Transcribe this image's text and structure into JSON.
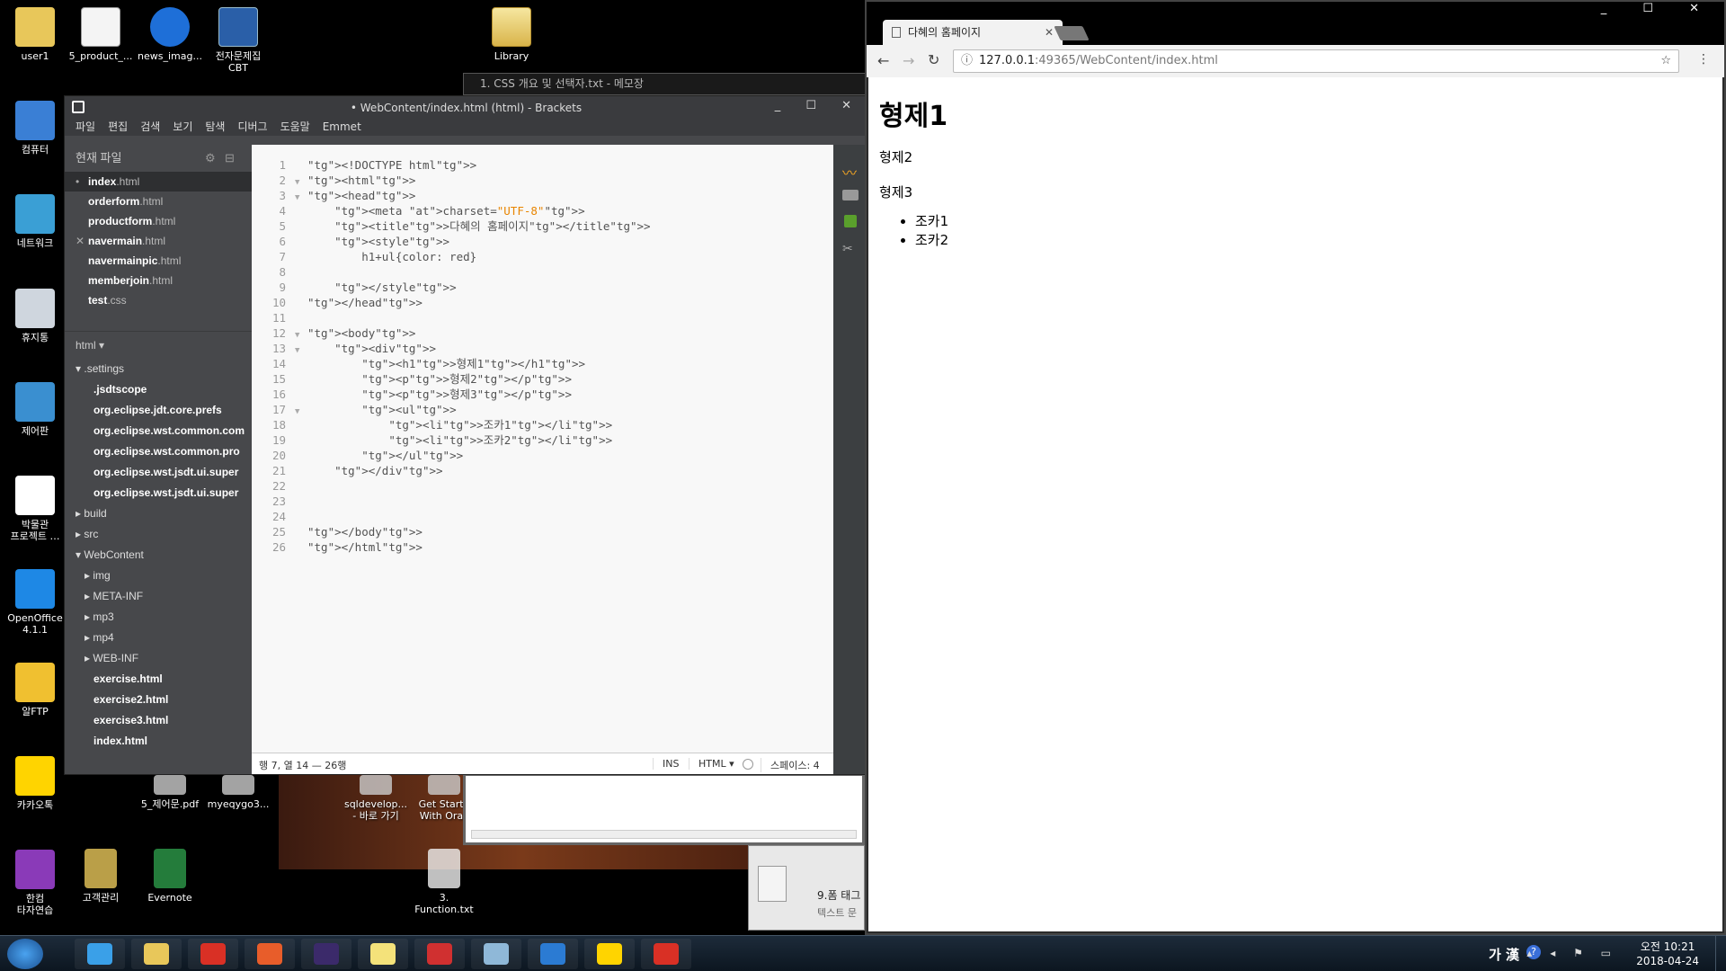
{
  "desktop": {
    "icons_left": [
      {
        "label": "user1",
        "color": "#e8c75a"
      },
      {
        "label": "컴퓨터",
        "color": "#3a7fd5"
      },
      {
        "label": "네트워크",
        "color": "#3a9fd5"
      },
      {
        "label": "휴지통",
        "color": "#cfd6de"
      },
      {
        "label": "제어판",
        "color": "#3a8fd0"
      },
      {
        "label": "박물관\n프로젝트 …",
        "color": "#ffffff"
      },
      {
        "label": "OpenOffice\n4.1.1",
        "color": "#1e88e5"
      },
      {
        "label": "알FTP",
        "color": "#f0c030"
      },
      {
        "label": "카카오톡",
        "color": "#ffd400"
      },
      {
        "label": "한컴\n타자연습",
        "color": "#8a3ab8"
      }
    ],
    "icons_top": [
      {
        "label": "5_product_...",
        "kind": "doc"
      },
      {
        "label": "news_imag...",
        "kind": "zip"
      },
      {
        "label": "전자문제집\nCBT",
        "kind": "app"
      },
      {
        "label": "Library",
        "kind": "folder"
      }
    ],
    "icons_bottom": [
      {
        "label": "5_제어문.pdf"
      },
      {
        "label": "myeqygo3..."
      },
      {
        "label": "sqldevelop...\n- 바로 가기"
      },
      {
        "label": "Get Starte\nWith Orac"
      },
      {
        "label": "고객관리"
      },
      {
        "label": "Evernote"
      },
      {
        "label": "3.\nFunction.txt"
      }
    ]
  },
  "notepad": {
    "title": "1. CSS 개요 및 선택자.txt - 메모장"
  },
  "notepad3": {
    "title": "9.폼 태그",
    "sub": "텍스트 문"
  },
  "brackets": {
    "title": "• WebContent/index.html (html) - Brackets",
    "window_controls": "_ ☐ ✕",
    "menu": [
      "파일",
      "편집",
      "검색",
      "보기",
      "탐색",
      "디버그",
      "도움말",
      "Emmet"
    ],
    "working_files_header": "현재 파일",
    "working_files": [
      {
        "name": "index",
        "ext": ".html",
        "active": true,
        "mark": "•"
      },
      {
        "name": "orderform",
        "ext": ".html",
        "active": false,
        "mark": ""
      },
      {
        "name": "productform",
        "ext": ".html",
        "active": false,
        "mark": ""
      },
      {
        "name": "navermain",
        "ext": ".html",
        "active": false,
        "mark": "✕"
      },
      {
        "name": "navermainpic",
        "ext": ".html",
        "active": false,
        "mark": ""
      },
      {
        "name": "memberjoin",
        "ext": ".html",
        "active": false,
        "mark": ""
      },
      {
        "name": "test",
        "ext": ".css",
        "active": false,
        "mark": ""
      }
    ],
    "project_name": "html ▾",
    "tree": [
      {
        "label": "▾ .settings",
        "indent": 0,
        "bold": false
      },
      {
        "label": ".jsdtscope",
        "indent": 2,
        "bold": true
      },
      {
        "label": "org.eclipse.jdt.core.prefs",
        "indent": 2,
        "bold": true
      },
      {
        "label": "org.eclipse.wst.common.com",
        "indent": 2,
        "bold": true
      },
      {
        "label": "org.eclipse.wst.common.pro",
        "indent": 2,
        "bold": true
      },
      {
        "label": "org.eclipse.wst.jsdt.ui.super",
        "indent": 2,
        "bold": true
      },
      {
        "label": "org.eclipse.wst.jsdt.ui.super",
        "indent": 2,
        "bold": true
      },
      {
        "label": "▸ build",
        "indent": 0,
        "bold": false
      },
      {
        "label": "▸ src",
        "indent": 0,
        "bold": false
      },
      {
        "label": "▾ WebContent",
        "indent": 0,
        "bold": false
      },
      {
        "label": "▸ img",
        "indent": 1,
        "bold": false
      },
      {
        "label": "▸ META-INF",
        "indent": 1,
        "bold": false
      },
      {
        "label": "▸ mp3",
        "indent": 1,
        "bold": false
      },
      {
        "label": "▸ mp4",
        "indent": 1,
        "bold": false
      },
      {
        "label": "▸ WEB-INF",
        "indent": 1,
        "bold": false
      },
      {
        "label": "exercise.html",
        "indent": 2,
        "bold": true
      },
      {
        "label": "exercise2.html",
        "indent": 2,
        "bold": true
      },
      {
        "label": "exercise3.html",
        "indent": 2,
        "bold": true
      },
      {
        "label": "index.html",
        "indent": 2,
        "bold": true
      }
    ],
    "code": [
      "<!DOCTYPE html>",
      "<html>",
      "<head>",
      "    <meta charset=\"UTF-8\">",
      "    <title>다혜의 홈페이지</title>",
      "    <style>",
      "        h1+ul{color: red}",
      "",
      "    </style>",
      "</head>",
      "",
      "<body>",
      "    <div>",
      "        <h1>형제1</h1>",
      "        <p>형제2</p>",
      "        <p>형제3</p>",
      "        <ul>",
      "            <li>조카1</li>",
      "            <li>조카2</li>",
      "        </ul>",
      "    </div>",
      "",
      "",
      "",
      "</body>",
      "</html>"
    ],
    "fold_lines": [
      2,
      3,
      12,
      13,
      17
    ],
    "status": {
      "position": "행 7, 열 14 — 26행",
      "mode": "INS",
      "lang": "HTML ▾",
      "spaces": "스페이스: 4"
    }
  },
  "chrome": {
    "tab_title": "다혜의 홈페이지",
    "tab_close": "✕",
    "url_host": "127.0.0.1",
    "url_rest": ":49365/WebContent/index.html",
    "window_controls": "_ ☐ ✕",
    "page": {
      "h1": "형제1",
      "p1": "형제2",
      "p2": "형제3",
      "li": [
        "조카1",
        "조카2"
      ]
    }
  },
  "taskbar": {
    "apps": [
      {
        "name": "start",
        "color": "#3a8ee6"
      },
      {
        "name": "ie",
        "color": "#3aa0e8"
      },
      {
        "name": "explorer",
        "color": "#e8c75a"
      },
      {
        "name": "chrome",
        "color": "#d93025"
      },
      {
        "name": "media",
        "color": "#e85d2a"
      },
      {
        "name": "eclipse",
        "color": "#3b2a6a"
      },
      {
        "name": "sticky",
        "color": "#f4e27a"
      },
      {
        "name": "snipping",
        "color": "#d03030"
      },
      {
        "name": "notepad",
        "color": "#8fb8d8"
      },
      {
        "name": "brackets",
        "color": "#2b7bd3"
      },
      {
        "name": "kakaotalk",
        "color": "#ffd400"
      },
      {
        "name": "chrome",
        "color": "#d93025"
      }
    ],
    "ime": "가 漢",
    "time": "오전 10:21",
    "date": "2018-04-24"
  }
}
